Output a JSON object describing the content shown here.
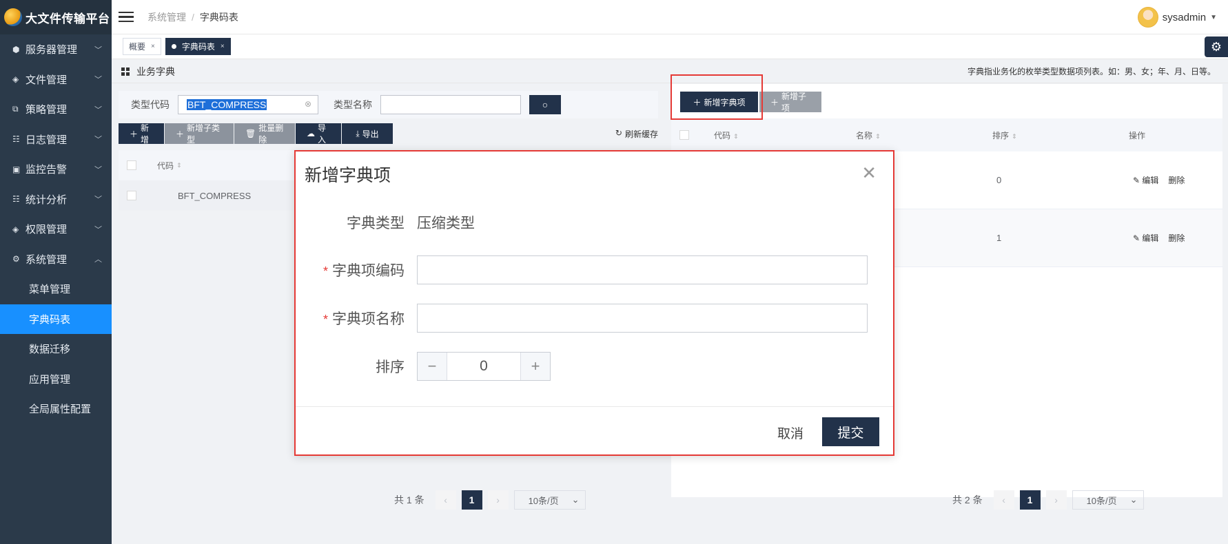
{
  "app": {
    "title": "大文件传输平台"
  },
  "sidebar": {
    "items": [
      {
        "label": "服务器管理",
        "icon": "cube-icon",
        "glyph": "⬢"
      },
      {
        "label": "文件管理",
        "icon": "layers-icon",
        "glyph": "◈"
      },
      {
        "label": "策略管理",
        "icon": "strategy-icon",
        "glyph": "⧉"
      },
      {
        "label": "日志管理",
        "icon": "log-icon",
        "glyph": "☷"
      },
      {
        "label": "监控告警",
        "icon": "monitor-icon",
        "glyph": "▣"
      },
      {
        "label": "统计分析",
        "icon": "chart-icon",
        "glyph": "☷"
      },
      {
        "label": "权限管理",
        "icon": "permission-icon",
        "glyph": "◈"
      },
      {
        "label": "系统管理",
        "icon": "settings-icon",
        "glyph": "⚙"
      }
    ],
    "sub_items": [
      {
        "label": "菜单管理"
      },
      {
        "label": "字典码表"
      },
      {
        "label": "数据迁移"
      },
      {
        "label": "应用管理"
      },
      {
        "label": "全局属性配置"
      }
    ]
  },
  "header": {
    "breadcrumb_parent": "系统管理",
    "breadcrumb_sep": "/",
    "breadcrumb_current": "字典码表",
    "username": "sysadmin"
  },
  "tabs": [
    {
      "label": "概要"
    },
    {
      "label": "字典码表"
    }
  ],
  "section": {
    "title": "业务字典",
    "note": "字典指业务化的枚举类型数据项列表。如：男、女；年、月、日等。"
  },
  "left": {
    "type_code_label": "类型代码",
    "type_code_value": "BFT_COMPRESS",
    "type_name_label": "类型名称",
    "type_name_value": "",
    "toolbar": {
      "add": "新增",
      "add_child_type": "新增子类型",
      "batch_delete": "批量删除",
      "import": "导入",
      "export": "导出",
      "refresh_cache": "刷新缓存"
    },
    "columns": [
      "代码"
    ],
    "rows": [
      {
        "code": "BFT_COMPRESS"
      }
    ],
    "pager": {
      "total": "共 1 条",
      "page": "1",
      "size": "10条/页"
    }
  },
  "right": {
    "toolbar": {
      "add_item": "新增字典项",
      "add_child": "新增子项"
    },
    "columns": [
      "代码",
      "名称",
      "排序",
      "操作"
    ],
    "rows": [
      {
        "sort": "0",
        "edit": "编辑",
        "delete": "删除"
      },
      {
        "sort": "1",
        "edit": "编辑",
        "delete": "删除"
      }
    ],
    "pager": {
      "total": "共 2 条",
      "page": "1",
      "size": "10条/页"
    }
  },
  "dialog": {
    "title": "新增字典项",
    "type_label": "字典类型",
    "type_value": "压缩类型",
    "code_label": "字典项编码",
    "code_value": "",
    "name_label": "字典项名称",
    "name_value": "",
    "sort_label": "排序",
    "sort_value": "0",
    "cancel": "取消",
    "submit": "提交"
  },
  "colors": {
    "primary_dark": "#22324a",
    "sidebar_bg": "#2b3a4a",
    "active_blue": "#1890ff",
    "highlight_red": "#e53935"
  }
}
